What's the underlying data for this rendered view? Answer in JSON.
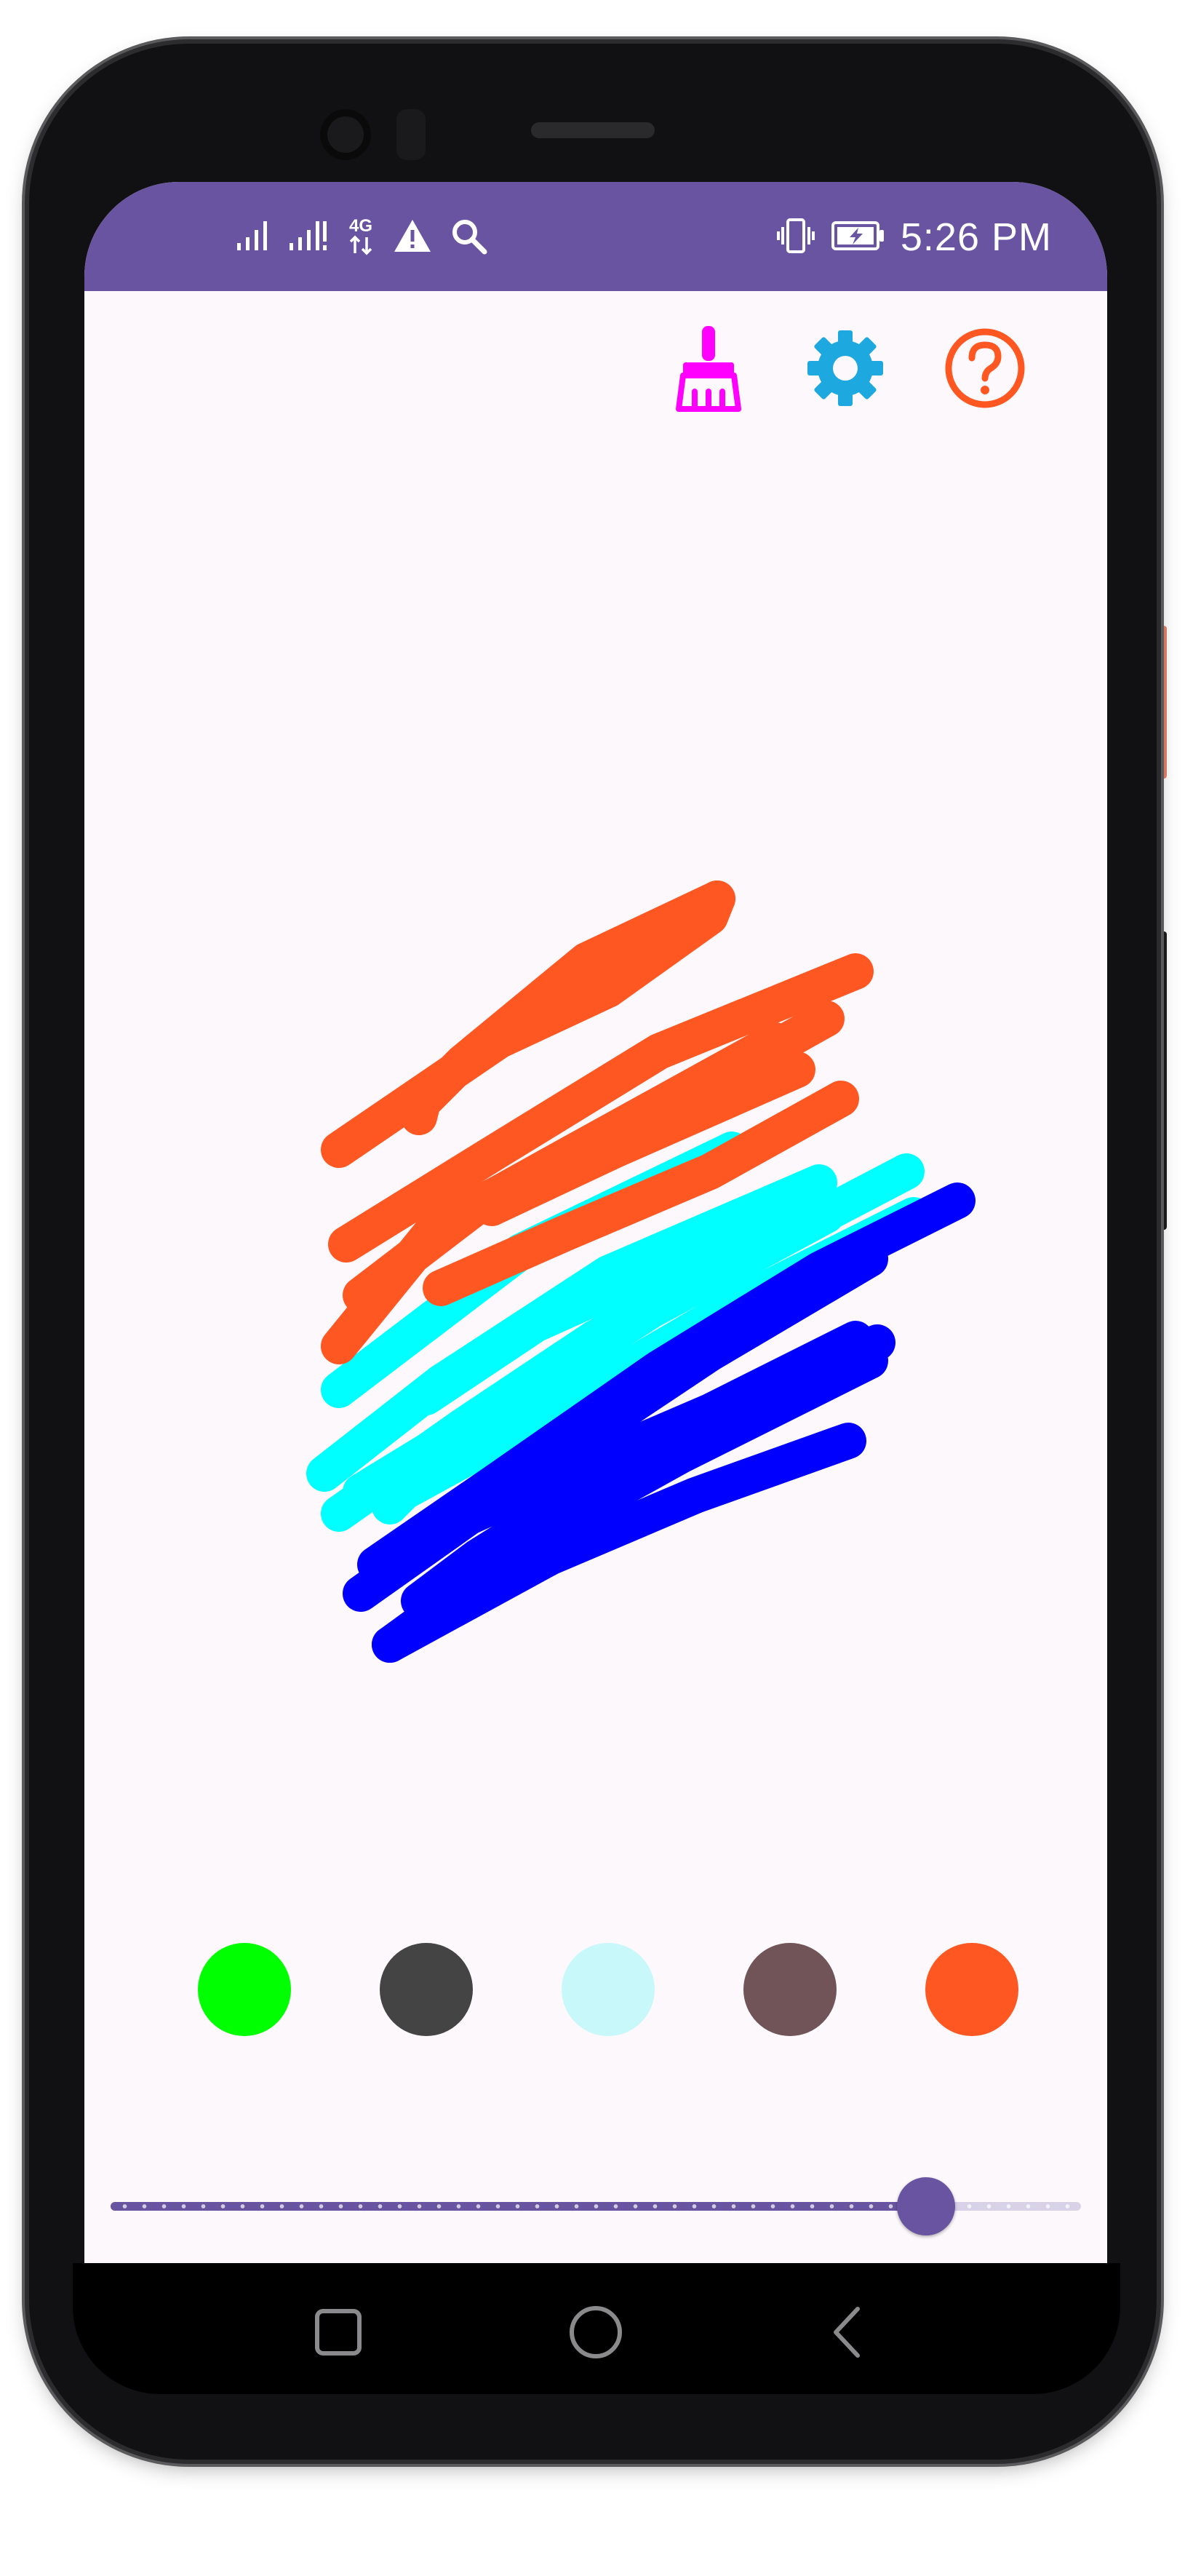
{
  "status_bar": {
    "time": "5:26 PM",
    "network_type": "4G",
    "icons_left": [
      "signal-icon",
      "signal-alert-icon",
      "network-4g-icon",
      "warning-icon",
      "search-icon"
    ],
    "icons_right": [
      "vibrate-icon",
      "battery-charging-icon"
    ]
  },
  "toolbar": {
    "buttons": [
      {
        "name": "clear-canvas-button",
        "icon": "broom-icon",
        "color": "#ff00ff"
      },
      {
        "name": "settings-button",
        "icon": "gear-icon",
        "color": "#1ea8e0"
      },
      {
        "name": "help-button",
        "icon": "help-icon",
        "color": "#ff5722"
      }
    ]
  },
  "canvas": {
    "stroke_colors": [
      "#ff5722",
      "#00ffff",
      "#0000ff"
    ]
  },
  "palette": {
    "colors": [
      "#00ff00",
      "#444444",
      "#c8f8fa",
      "#705458",
      "#ff5722"
    ]
  },
  "brush_size_slider": {
    "value": 0.84
  },
  "nav_bar": {
    "buttons": [
      "recent-apps-button",
      "home-button",
      "back-button"
    ]
  },
  "colors": {
    "accent": "#6954a2",
    "background": "#fdf8fc"
  }
}
